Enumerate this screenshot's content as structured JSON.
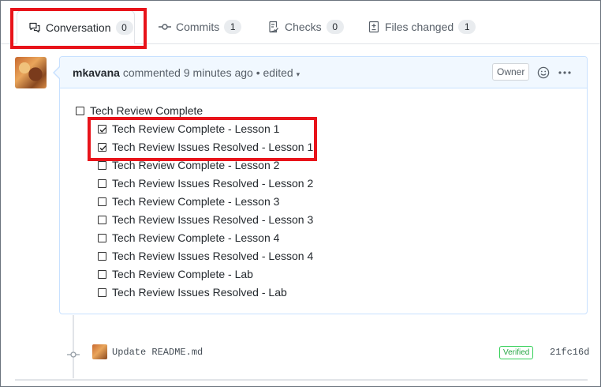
{
  "tabs": [
    {
      "label": "Conversation",
      "count": "0",
      "icon": "comment-discussion-icon"
    },
    {
      "label": "Commits",
      "count": "1",
      "icon": "git-commit-icon"
    },
    {
      "label": "Checks",
      "count": "0",
      "icon": "checklist-icon"
    },
    {
      "label": "Files changed",
      "count": "1",
      "icon": "diff-icon"
    }
  ],
  "comment": {
    "author": "mkavana",
    "action": "commented",
    "time": "9 minutes ago",
    "separator": "•",
    "edited": "edited",
    "edited_caret": "▾",
    "owner_badge": "Owner",
    "tasks": [
      {
        "label": "Tech Review Complete",
        "checked": false
      },
      {
        "label": "Tech Review Complete - Lesson 1",
        "checked": true
      },
      {
        "label": "Tech Review Issues Resolved - Lesson 1",
        "checked": true
      },
      {
        "label": "Tech Review Complete - Lesson 2",
        "checked": false
      },
      {
        "label": "Tech Review Issues Resolved - Lesson 2",
        "checked": false
      },
      {
        "label": "Tech Review Complete - Lesson 3",
        "checked": false
      },
      {
        "label": "Tech Review Issues Resolved - Lesson 3",
        "checked": false
      },
      {
        "label": "Tech Review Complete - Lesson 4",
        "checked": false
      },
      {
        "label": "Tech Review Issues Resolved - Lesson 4",
        "checked": false
      },
      {
        "label": "Tech Review Complete - Lab",
        "checked": false
      },
      {
        "label": "Tech Review Issues Resolved - Lab",
        "checked": false
      }
    ]
  },
  "commit": {
    "message": "Update README.md",
    "verified": "Verified",
    "sha": "21fc16d"
  },
  "colors": {
    "highlight": "#e8131a",
    "comment_border": "#c8e1ff",
    "comment_header_bg": "#f1f8ff",
    "verified": "#28a745"
  }
}
